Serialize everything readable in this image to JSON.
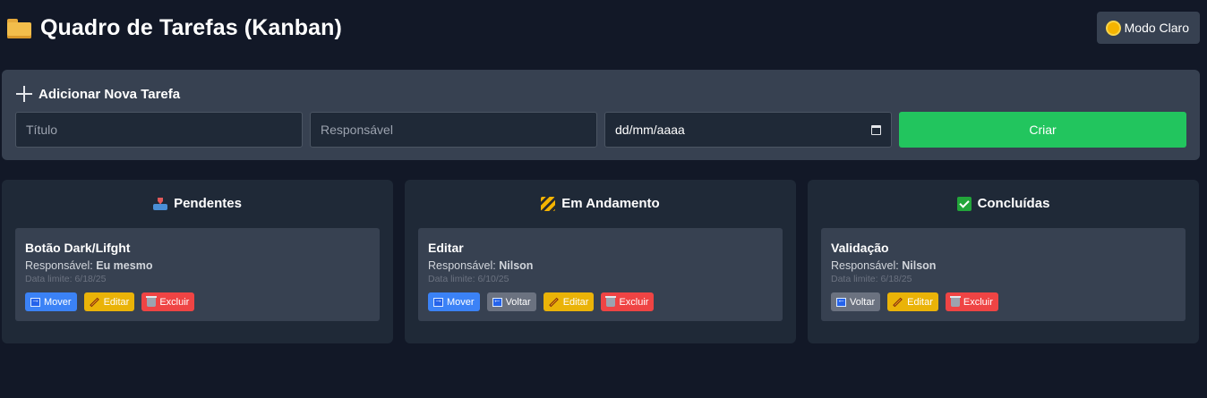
{
  "header": {
    "title": "Quadro de Tarefas (Kanban)",
    "theme_toggle_label": "Modo Claro"
  },
  "add_task": {
    "heading": "Adicionar Nova Tarefa",
    "title_placeholder": "Título",
    "assignee_placeholder": "Responsável",
    "date_placeholder": "dd/mm/aaaa",
    "create_label": "Criar"
  },
  "labels": {
    "assignee_prefix": "Responsável:",
    "due_prefix": "Data limite:",
    "move": "Mover",
    "back": "Voltar",
    "edit": "Editar",
    "delete": "Excluir"
  },
  "columns": [
    {
      "title": "Pendentes",
      "icon": "inbox-tray-icon",
      "tasks": [
        {
          "title": "Botão Dark/Lifght",
          "assignee": "Eu mesmo",
          "due": "6/18/25"
        }
      ]
    },
    {
      "title": "Em Andamento",
      "icon": "construction-icon",
      "tasks": [
        {
          "title": "Editar",
          "assignee": "Nilson",
          "due": "6/10/25"
        }
      ]
    },
    {
      "title": "Concluídas",
      "icon": "check-mark-icon",
      "tasks": [
        {
          "title": "Validação",
          "assignee": "Nilson",
          "due": "6/18/25"
        }
      ]
    }
  ],
  "colors": {
    "background": "#121827",
    "panel": "#374151",
    "column": "#1f2937",
    "create": "#22c55e",
    "move": "#3b82f6",
    "back": "#6b7280",
    "edit": "#eab308",
    "delete": "#ef4444"
  }
}
